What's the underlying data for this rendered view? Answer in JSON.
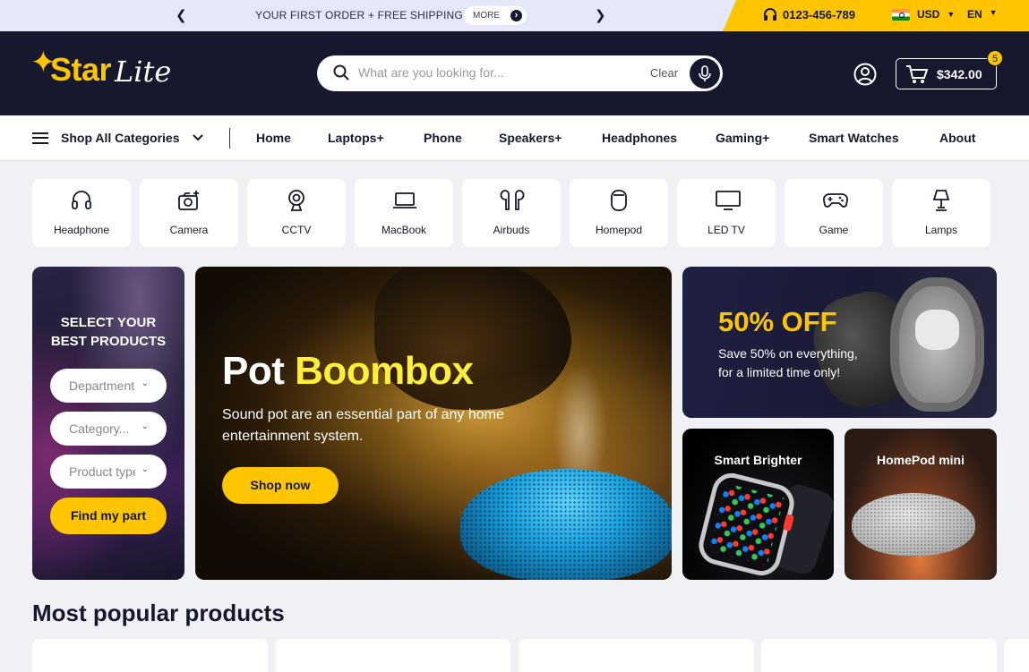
{
  "topbar": {
    "promo": "YOUR FIRST ORDER + FREE SHIPPING",
    "more": "MORE",
    "phone": "0123-456-789",
    "currency": "USD",
    "language": "EN"
  },
  "header": {
    "logo_part1": "Star",
    "logo_part2": "Lite",
    "search_placeholder": "What are you looking for...",
    "search_clear": "Clear",
    "cart_total": "$342.00",
    "cart_count": "5"
  },
  "nav": {
    "all_categories": "Shop All Categories",
    "links": [
      "Home",
      "Laptops",
      "Phone",
      "Speakers",
      "Headphones",
      "Gaming",
      "Smart Watches",
      "About"
    ]
  },
  "categories": [
    "Headphone",
    "Camera",
    "CCTV",
    "MacBook",
    "Airbuds",
    "Homepod",
    "LED TV",
    "Game",
    "Lamps"
  ],
  "selector": {
    "title_line1": "SELECT YOUR",
    "title_line2": "BEST PRODUCTS",
    "field1": "Department",
    "field2": "Category...",
    "field3": "Product type",
    "button": "Find my part"
  },
  "hero": {
    "title_part1": "Pot",
    "title_part2": "Boombox",
    "description": "Sound pot are an essential part of any home entertainment system.",
    "button": "Shop now"
  },
  "offer": {
    "headline": "50% OFF",
    "line1": "Save 50% on everything,",
    "line2": "for a limited time only!"
  },
  "promo_cards": {
    "watch": "Smart Brighter",
    "homepod": "HomePod mini"
  },
  "popular": {
    "title": "Most popular products"
  },
  "colors": {
    "navy": "#16182e",
    "accent_yellow": "#fdc500",
    "hero_highlight": "#ffef3a"
  }
}
